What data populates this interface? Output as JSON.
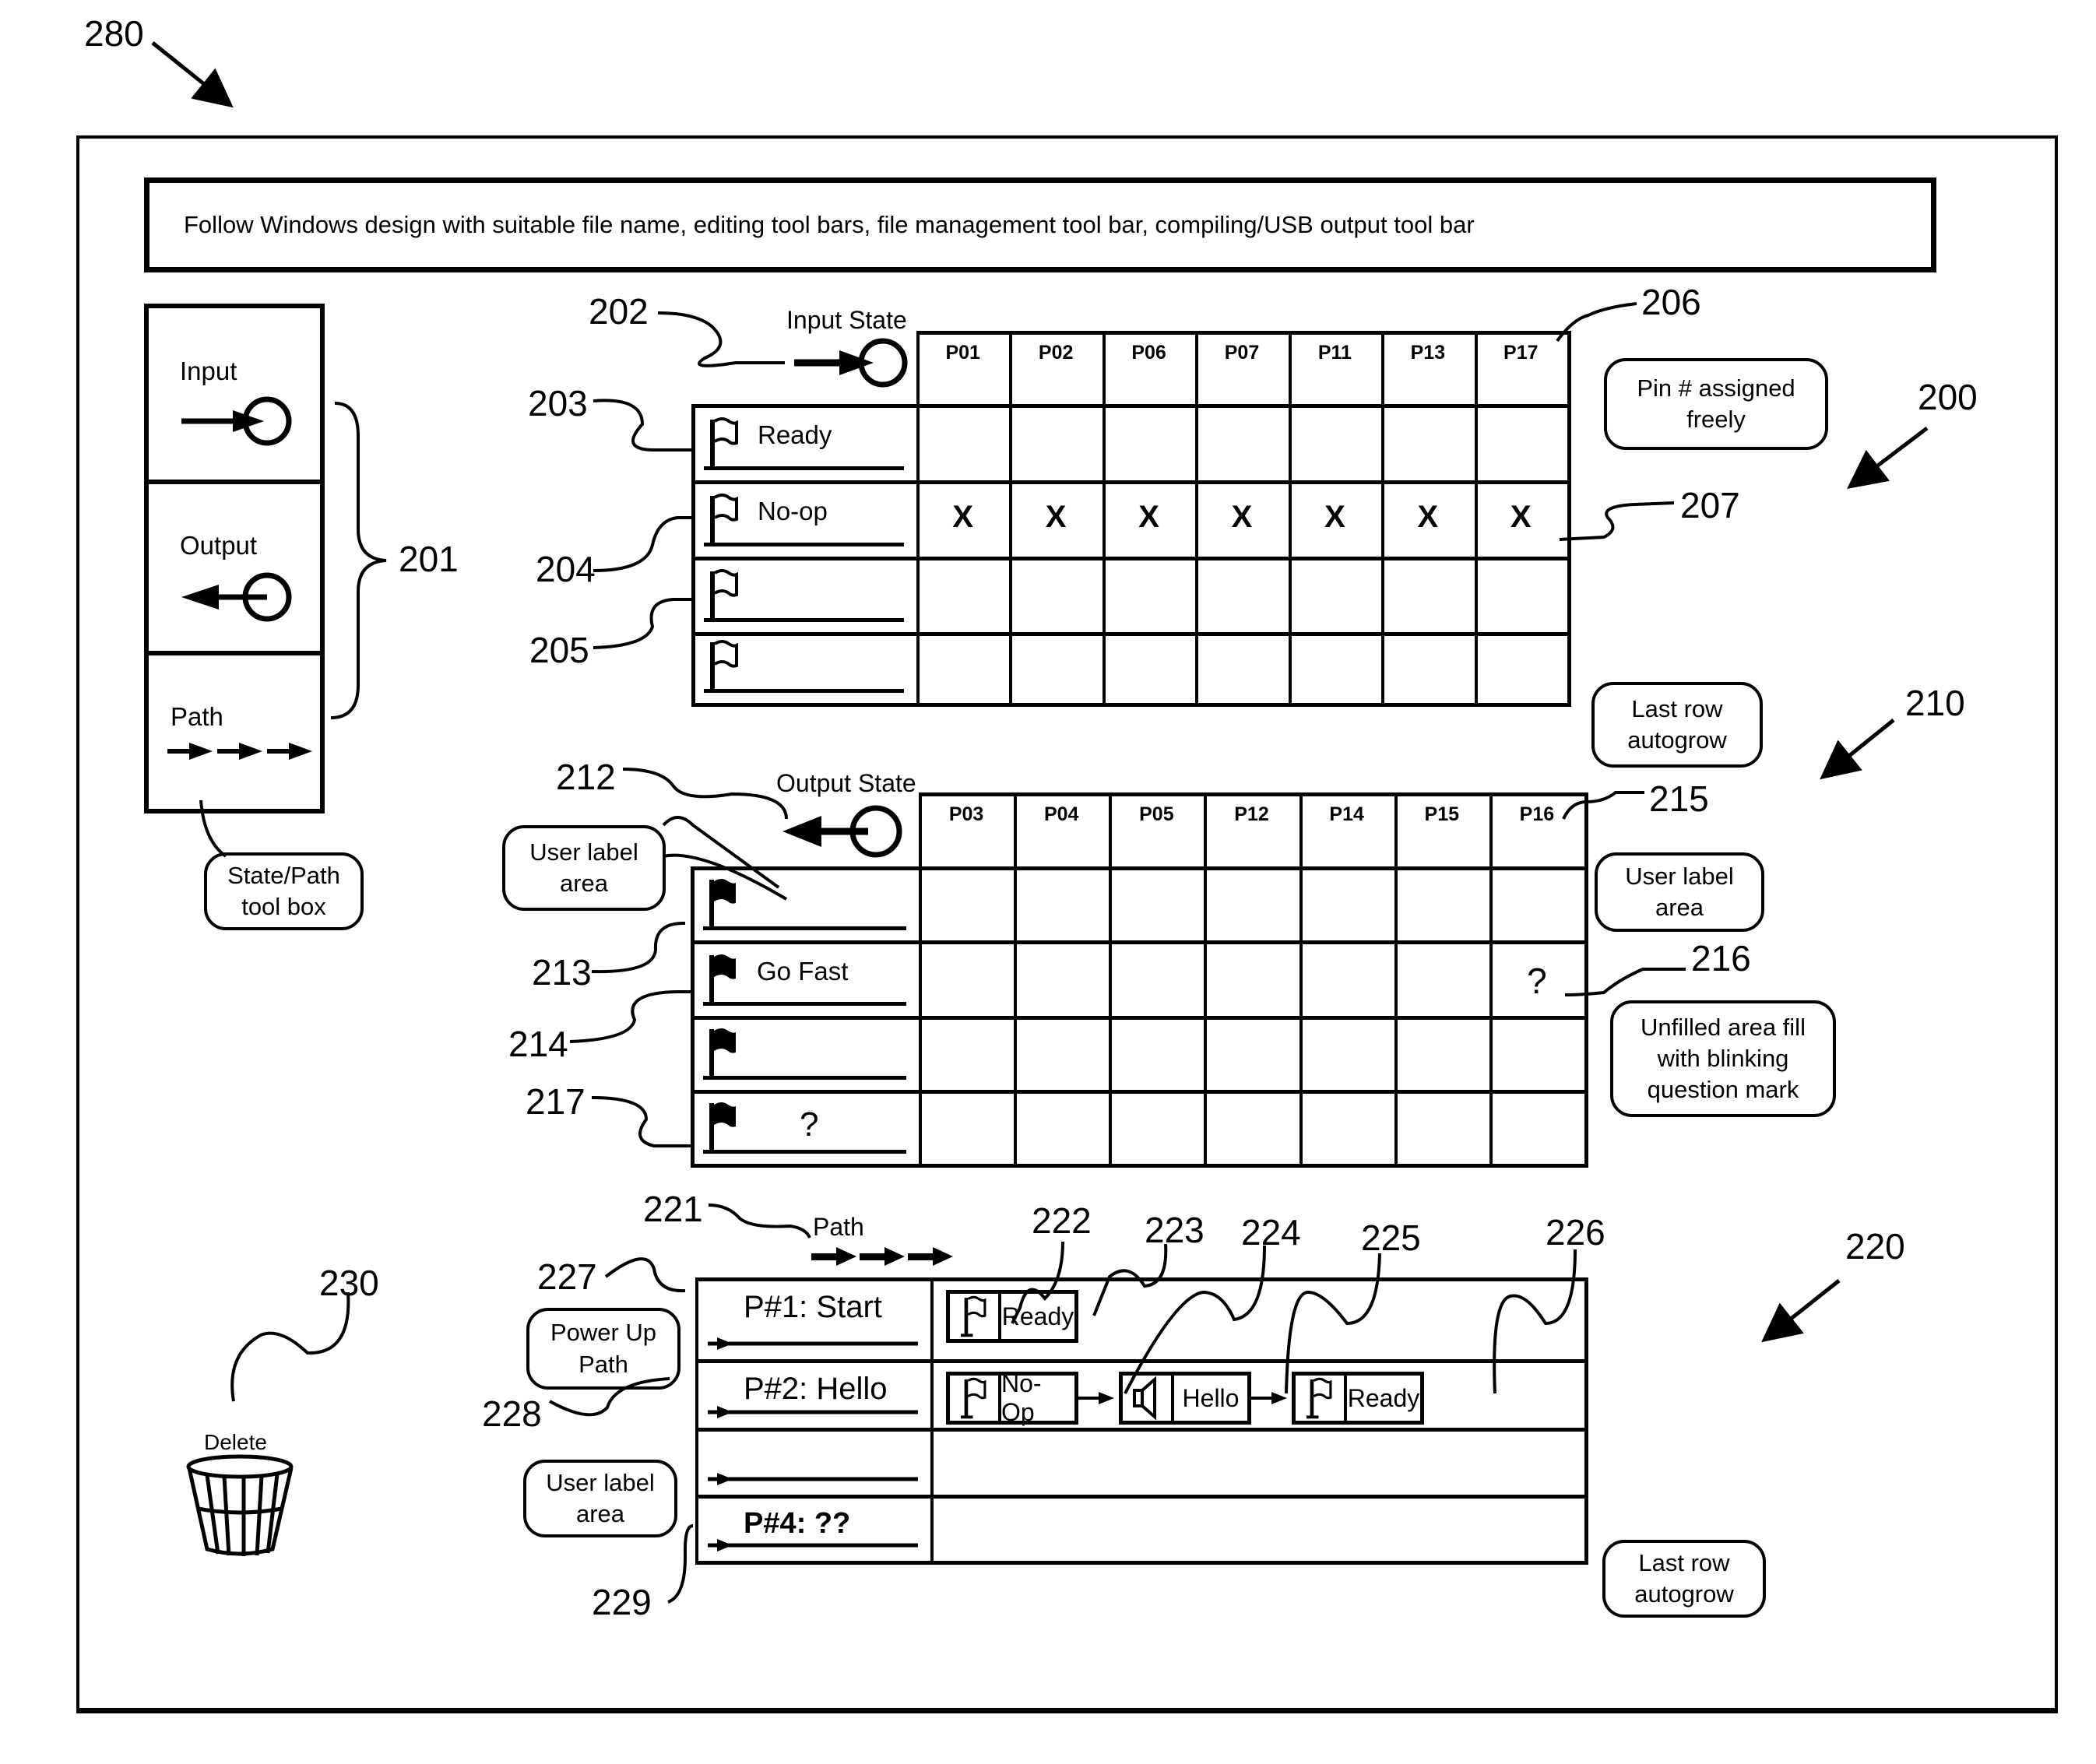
{
  "figure_refs": {
    "main": "280",
    "toolbox": "201",
    "input_state": "202",
    "input_row_ready": "203",
    "input_row_noop": "204",
    "input_row_blank": "205",
    "input_pin_header": "206",
    "input_x_marks": "207",
    "input_section": "200",
    "output_section": "210",
    "output_state": "212",
    "output_row_blank": "213",
    "output_row_gofast": "214",
    "output_pin_header": "215",
    "output_unfilled": "216",
    "output_row_unlabeled": "217",
    "path_section": "220",
    "path_tool": "221",
    "path_icon_ready": "222",
    "path_label_ready": "223",
    "path_label_noop": "224",
    "path_label_hello": "225",
    "path_label_ready2": "226",
    "path_row_start": "227",
    "path_row_hello": "228",
    "path_row_unlabeled": "229",
    "delete": "230"
  },
  "header": {
    "text": "Follow Windows design with suitable file name, editing tool bars, file management tool bar, compiling/USB output tool bar"
  },
  "toolbox": {
    "items": [
      {
        "label": "Input",
        "icon": "input-arrow-circle-icon"
      },
      {
        "label": "Output",
        "icon": "output-arrow-circle-icon"
      },
      {
        "label": "Path",
        "icon": "path-arrows-icon"
      }
    ],
    "callout": "State/Path tool box"
  },
  "input_table": {
    "title": "Input State",
    "pins": [
      "P01",
      "P02",
      "P06",
      "P07",
      "P11",
      "P13",
      "P17"
    ],
    "rows": [
      {
        "label": "Ready",
        "cells": [
          "",
          "",
          "",
          "",
          "",
          "",
          ""
        ]
      },
      {
        "label": "No-op",
        "cells": [
          "X",
          "X",
          "X",
          "X",
          "X",
          "X",
          "X"
        ]
      },
      {
        "label": "",
        "cells": [
          "",
          "",
          "",
          "",
          "",
          "",
          ""
        ]
      },
      {
        "label": "",
        "cells": [
          "",
          "",
          "",
          "",
          "",
          "",
          ""
        ]
      }
    ],
    "callouts": {
      "pins": "Pin # assigned freely",
      "autogrow": "Last row autogrow"
    }
  },
  "output_table": {
    "title": "Output State",
    "pins": [
      "P03",
      "P04",
      "P05",
      "P12",
      "P14",
      "P15",
      "P16"
    ],
    "rows": [
      {
        "label": "",
        "cells": [
          "",
          "",
          "",
          "",
          "",
          "",
          ""
        ]
      },
      {
        "label": "Go Fast",
        "cells": [
          "",
          "",
          "",
          "",
          "",
          "",
          "?"
        ]
      },
      {
        "label": "",
        "cells": [
          "",
          "",
          "",
          "",
          "",
          "",
          ""
        ]
      },
      {
        "label": "?",
        "cells": [
          "",
          "",
          "",
          "",
          "",
          "",
          ""
        ]
      }
    ],
    "callouts": {
      "user_label_left": "User label area",
      "user_label_right": "User label area",
      "unfilled": "Unfilled area fill with blinking question mark"
    }
  },
  "path_table": {
    "title": "Path",
    "rows": [
      {
        "label": "P#1: Start",
        "items": [
          {
            "icon": "flag-icon",
            "label": "Ready"
          }
        ]
      },
      {
        "label": "P#2: Hello",
        "items": [
          {
            "icon": "flag-icon",
            "label": "No-Op"
          },
          {
            "icon": "speaker-icon",
            "label": "Hello"
          },
          {
            "icon": "flag-icon",
            "label": "Ready"
          }
        ]
      },
      {
        "label": "",
        "items": []
      },
      {
        "label": "P#4: ??",
        "items": []
      }
    ],
    "callouts": {
      "power_up": "Power Up Path",
      "user_label": "User label area",
      "autogrow": "Last row autogrow"
    }
  },
  "delete": {
    "label": "Delete",
    "icon": "trash-basket-icon"
  }
}
